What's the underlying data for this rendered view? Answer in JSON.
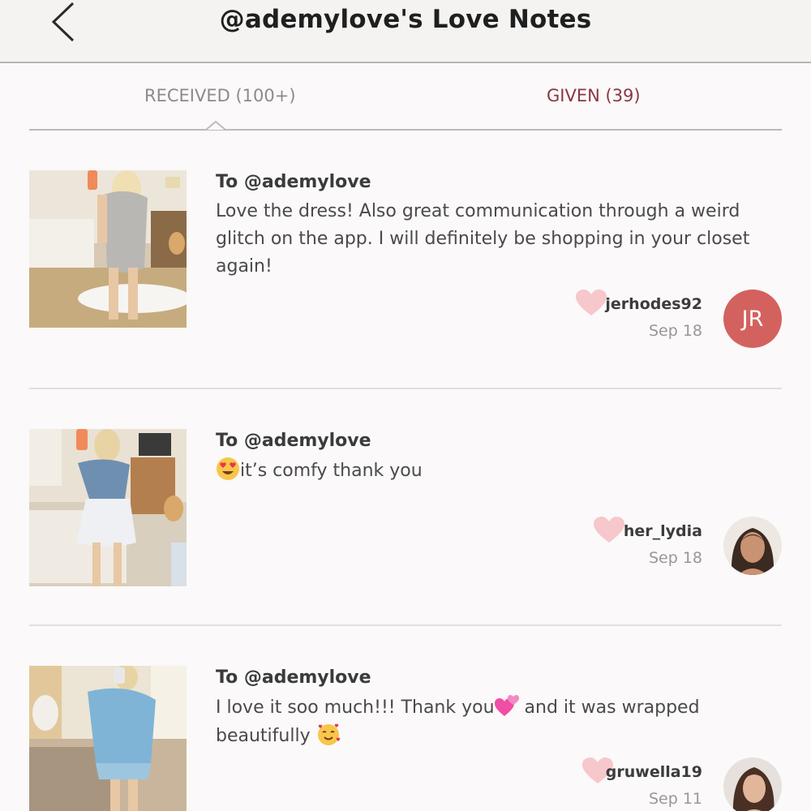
{
  "header": {
    "title": "@ademylove's Love Notes",
    "back_icon": "chevron-left-icon"
  },
  "tabs": {
    "received": {
      "label": "RECEIVED",
      "count": "(100+)"
    },
    "given": {
      "label": "GIVEN",
      "count": "(39)"
    },
    "active": "received"
  },
  "colors": {
    "accent": "#8a3647",
    "heart": "#f6c7cb",
    "avatar_jr": "#d3625f"
  },
  "notes": [
    {
      "to": "To @ademylove",
      "body": "Love the dress! Also great communication through a weird glitch on the app. I will definitely be shopping in your closet again!",
      "sender": "jerhodes92",
      "date": "Sep 18",
      "avatar_initials": "JR"
    },
    {
      "to": "To @ademylove",
      "body_emoji": "heart-eyes-emoji",
      "body": "it’s comfy thank you",
      "sender": "her_lydia",
      "date": "Sep 18"
    },
    {
      "to": "To @ademylove",
      "body_part1": "I love it soo much!!! Thank you",
      "body_emoji1": "two-hearts-emoji",
      "body_part2": " and it was wrapped beautifully ",
      "body_emoji2": "smiling-face-with-hearts-emoji",
      "sender": "gruwella19",
      "date": "Sep 11"
    }
  ]
}
